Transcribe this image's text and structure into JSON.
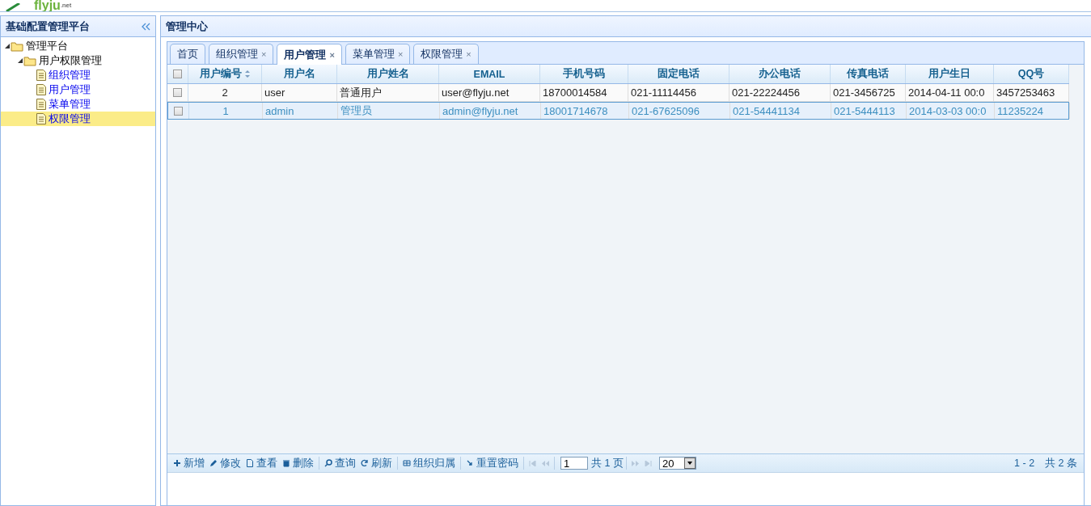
{
  "header": {
    "logo": "flyju",
    "logo_suffix": ".net"
  },
  "sidebar": {
    "title": "基础配置管理平台",
    "tree": [
      {
        "label": "管理平台",
        "expanded": true,
        "selected": false,
        "children": [
          {
            "label": "用户权限管理",
            "expanded": true,
            "selected": false,
            "children": [
              {
                "label": "组织管理",
                "selected": false
              },
              {
                "label": "用户管理",
                "selected": false
              },
              {
                "label": "菜单管理",
                "selected": false
              },
              {
                "label": "权限管理",
                "selected": true
              }
            ]
          }
        ]
      }
    ]
  },
  "main": {
    "title": "管理中心",
    "tabs": [
      {
        "label": "首页",
        "selected": false
      },
      {
        "label": "组织管理",
        "close": "×",
        "selected": false
      },
      {
        "label": "用户管理",
        "close": "×",
        "selected": true
      },
      {
        "label": "菜单管理",
        "close": "×",
        "selected": false
      },
      {
        "label": "权限管理",
        "close": "×",
        "selected": false
      }
    ],
    "table": {
      "columns": [
        {
          "label": "用户编号"
        },
        {
          "label": "用户名"
        },
        {
          "label": "用户姓名"
        },
        {
          "label": "EMAIL"
        },
        {
          "label": "手机号码"
        },
        {
          "label": "固定电话"
        },
        {
          "label": "办公电话"
        },
        {
          "label": "传真电话"
        },
        {
          "label": "用户生日"
        },
        {
          "label": "QQ号"
        }
      ],
      "header_checked": false,
      "rows": [
        {
          "checked": false,
          "selected": false,
          "cells": [
            "2",
            "user",
            "普通用户",
            "user@flyju.net",
            "18700014584",
            "021-11114456",
            "021-22224456",
            "021-3456725",
            "2014-04-11 00:0",
            "3457253463"
          ]
        },
        {
          "checked": false,
          "selected": true,
          "cells": [
            "1",
            "admin",
            "管理员",
            "admin@flyju.net",
            "18001714678",
            "021-67625096",
            "021-54441134",
            "021-5444113",
            "2014-03-03 00:0",
            "11235224"
          ]
        }
      ]
    },
    "toolbar": {
      "groups": [
        [
          {
            "label": "新增"
          },
          {
            "label": "修改"
          },
          {
            "label": "查看"
          },
          {
            "label": "删除"
          }
        ],
        [
          {
            "label": "查询"
          },
          {
            "label": "刷新"
          }
        ],
        [
          {
            "label": "组织归属"
          }
        ],
        [
          {
            "label": "重置密码"
          }
        ]
      ]
    },
    "pager": {
      "page": "1",
      "total_pages": "共 1 页",
      "page_size": "20",
      "summary": "1 - 2　共 2 条"
    }
  }
}
